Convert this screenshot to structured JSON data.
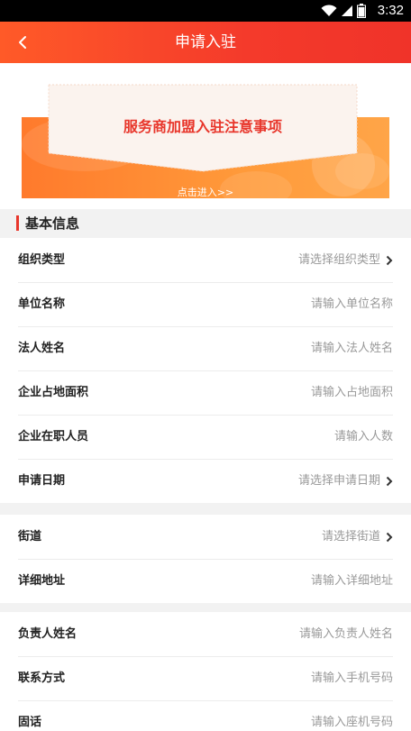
{
  "status_bar": {
    "time": "3:32"
  },
  "app_bar": {
    "title": "申请入驻"
  },
  "banner": {
    "notice_title": "服务商加盟入驻注意事项",
    "link_text": "点击进入>>"
  },
  "section": {
    "title": "基本信息"
  },
  "groups": [
    {
      "rows": [
        {
          "label": "组织类型",
          "value": "请选择组织类型",
          "chevron": true
        },
        {
          "label": "单位名称",
          "value": "请输入单位名称",
          "chevron": false
        },
        {
          "label": "法人姓名",
          "value": "请输入法人姓名",
          "chevron": false
        },
        {
          "label": "企业占地面积",
          "value": "请输入占地面积",
          "chevron": false
        },
        {
          "label": "企业在职人员",
          "value": "请输入人数",
          "chevron": false
        },
        {
          "label": "申请日期",
          "value": "请选择申请日期",
          "chevron": true
        }
      ]
    },
    {
      "rows": [
        {
          "label": "街道",
          "value": "请选择街道",
          "chevron": true
        },
        {
          "label": "详细地址",
          "value": "请输入详细地址",
          "chevron": false
        }
      ]
    },
    {
      "rows": [
        {
          "label": "负责人姓名",
          "value": "请输入负责人姓名",
          "chevron": false
        },
        {
          "label": "联系方式",
          "value": "请输入手机号码",
          "chevron": false
        },
        {
          "label": "固话",
          "value": "请输入座机号码",
          "chevron": false
        }
      ]
    }
  ],
  "colors": {
    "accent": "#e8362b",
    "banner": "#ff8a34",
    "label": "#222222",
    "placeholder": "#999999"
  },
  "icons": {
    "wifi": "wifi-icon",
    "signal": "signal-icon",
    "battery": "battery-icon",
    "back": "back-arrow-icon",
    "chevron": "chevron-right-icon"
  }
}
